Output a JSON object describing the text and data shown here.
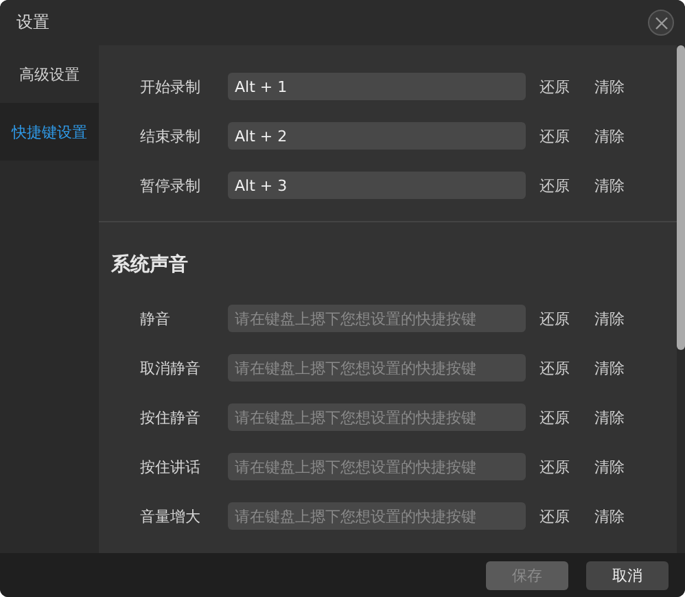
{
  "window": {
    "title": "设置"
  },
  "sidebar": {
    "items": [
      {
        "label": "高级设置",
        "selected": false
      },
      {
        "label": "快捷键设置",
        "selected": true
      }
    ]
  },
  "sections": [
    {
      "rows": [
        {
          "label": "开始录制",
          "value": "Alt + 1",
          "reset": "还原",
          "clear": "清除"
        },
        {
          "label": "结束录制",
          "value": "Alt + 2",
          "reset": "还原",
          "clear": "清除"
        },
        {
          "label": "暂停录制",
          "value": "Alt + 3",
          "reset": "还原",
          "clear": "清除"
        }
      ]
    },
    {
      "heading": "系统声音",
      "rows": [
        {
          "label": "静音",
          "placeholder": "请在键盘上摁下您想设置的快捷按键",
          "reset": "还原",
          "clear": "清除"
        },
        {
          "label": "取消静音",
          "placeholder": "请在键盘上摁下您想设置的快捷按键",
          "reset": "还原",
          "clear": "清除"
        },
        {
          "label": "按住静音",
          "placeholder": "请在键盘上摁下您想设置的快捷按键",
          "reset": "还原",
          "clear": "清除"
        },
        {
          "label": "按住讲话",
          "placeholder": "请在键盘上摁下您想设置的快捷按键",
          "reset": "还原",
          "clear": "清除"
        },
        {
          "label": "音量增大",
          "placeholder": "请在键盘上摁下您想设置的快捷按键",
          "reset": "还原",
          "clear": "清除"
        }
      ]
    }
  ],
  "buttons": [
    {
      "label": "保存",
      "disabled": true
    },
    {
      "label": "取消",
      "disabled": false
    }
  ]
}
